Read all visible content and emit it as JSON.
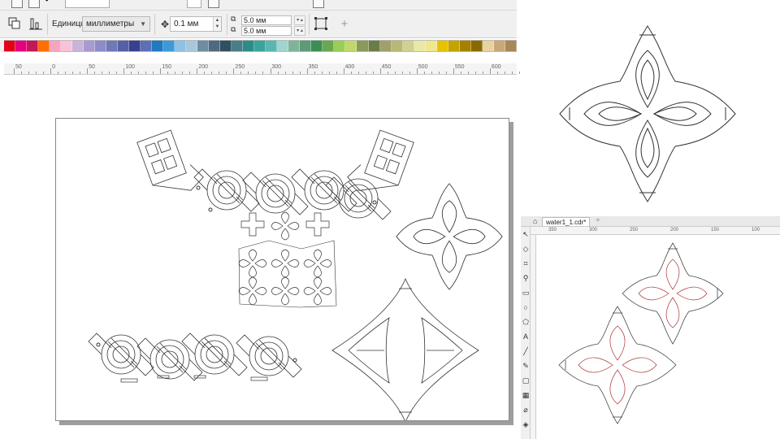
{
  "main_window": {
    "propbar": {
      "units_label": "Единицы:",
      "units_value": "миллиметры",
      "nudge_value": "0.1 мм",
      "duplicate_x": "5.0 мм",
      "duplicate_y": "5.0 мм"
    },
    "palette": [
      "#e2001a",
      "#e5007d",
      "#c2185b",
      "#ff6f00",
      "#f6a5c0",
      "#f7c3d5",
      "#c9b3d8",
      "#a79bd0",
      "#8e8cc8",
      "#7078b6",
      "#5560a6",
      "#3a3f8f",
      "#5d6fb5",
      "#1f7bc1",
      "#3d9ad6",
      "#8fc1e5",
      "#a9c7db",
      "#6f8ca3",
      "#4f6a80",
      "#2f4f63",
      "#4a7e85",
      "#2e8b8b",
      "#3aa39c",
      "#58b7b0",
      "#9fd5cb",
      "#7fb49a",
      "#5d9a76",
      "#3c8f54",
      "#6aa84f",
      "#9acd58",
      "#c3d66a",
      "#8a9a5b",
      "#6b7b4a",
      "#a0a06a",
      "#b8b878",
      "#d0d090",
      "#e8e8a8",
      "#f0e68c",
      "#e6c200",
      "#c5a300",
      "#a68100",
      "#8a6a00",
      "#e8d2a0",
      "#c8a878",
      "#a88858"
    ],
    "ruler_labels": [
      "50",
      "0",
      "50",
      "100",
      "150",
      "200",
      "250",
      "300",
      "350",
      "400",
      "450",
      "500",
      "550",
      "600"
    ]
  },
  "second_window": {
    "tab_title": "water1_1.cdr*",
    "ruler_labels": [
      "350",
      "300",
      "250",
      "200",
      "150",
      "100"
    ]
  }
}
